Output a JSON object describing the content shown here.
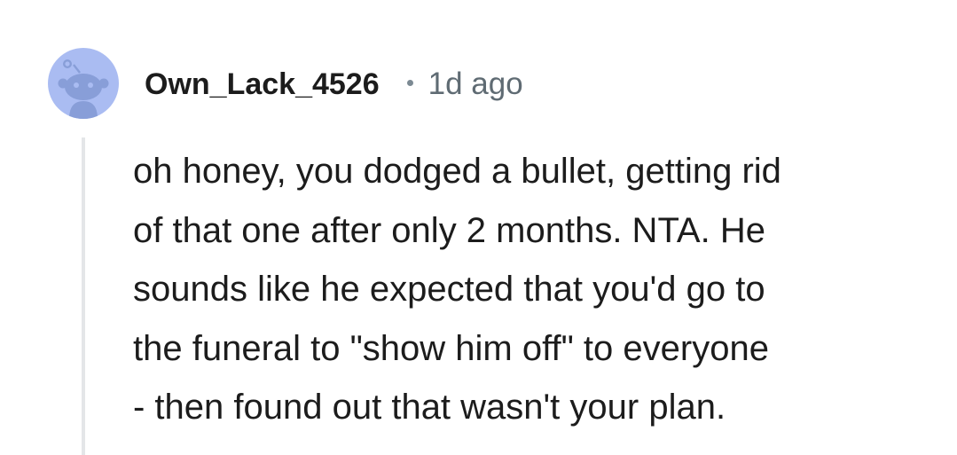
{
  "comment": {
    "username": "Own_Lack_4526",
    "separator": "•",
    "timestamp": "1d ago",
    "avatar_icon": "reddit-snoo-avatar-icon",
    "body_lines": [
      "oh honey, you dodged a bullet, getting rid",
      "of that one after only 2 months. NTA. He",
      "sounds like he expected that you'd go to",
      "the funeral to \"show him off\" to everyone",
      "- then found out that wasn't your plan."
    ]
  },
  "colors": {
    "avatar_background": "#aabcf2",
    "snoo_body": "#889ed8",
    "text": "#1c1c1c",
    "meta_text": "#5f6b73",
    "thread_line": "#e4e6e8"
  }
}
